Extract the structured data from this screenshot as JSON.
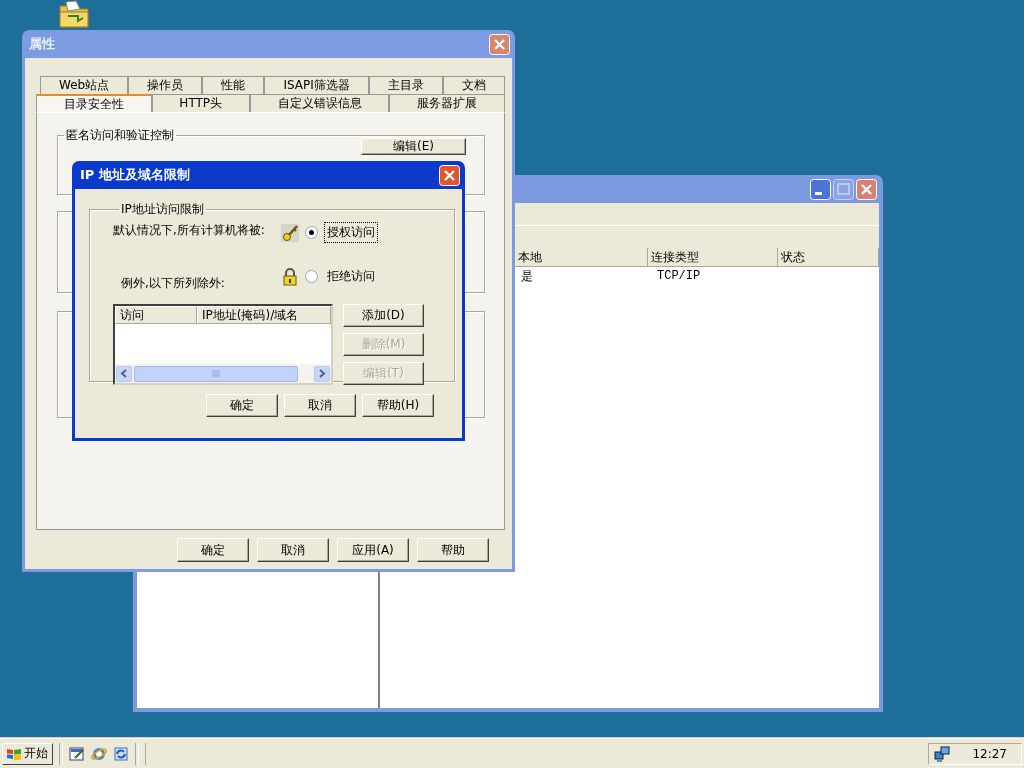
{
  "back_window": {
    "list": {
      "columns": [
        "本地",
        "连接类型",
        "状态"
      ],
      "rows": [
        {
          "cells": [
            "是",
            "TCP/IP"
          ]
        }
      ]
    }
  },
  "properties_window": {
    "title": "属性",
    "tab_rows": [
      [
        {
          "label": "Web站点",
          "selected": false
        },
        {
          "label": "操作员",
          "selected": false
        },
        {
          "label": "性能",
          "selected": false
        },
        {
          "label": "ISAPI筛选器",
          "selected": false
        },
        {
          "label": "主目录",
          "selected": false
        },
        {
          "label": "文档",
          "selected": false
        }
      ],
      [
        {
          "label": "目录安全性",
          "selected": true
        },
        {
          "label": "HTTP头",
          "selected": false
        },
        {
          "label": "自定义错误信息",
          "selected": false
        },
        {
          "label": "服务器扩展",
          "selected": false
        }
      ]
    ],
    "anonymous_group": {
      "title": "匿名访问和验证控制",
      "button": "编辑(E)"
    },
    "buttons": [
      "确定",
      "取消",
      "应用(A)",
      "帮助"
    ]
  },
  "ip_dialog": {
    "title": "IP 地址及域名限制",
    "group_title": "IP地址访问限制",
    "default_label": "默认情况下,所有计算机将被:",
    "exceptions_label": "例外,以下所列除外:",
    "options": [
      {
        "kind": "key",
        "label": "授权访问",
        "selected": true
      },
      {
        "kind": "lock",
        "label": "拒绝访问",
        "selected": false
      }
    ],
    "list": {
      "columns": [
        "访问",
        "IP地址(掩码)/域名"
      ]
    },
    "side_buttons": [
      {
        "label": "添加(D)",
        "disabled": false
      },
      {
        "label": "删除(M)",
        "disabled": true
      },
      {
        "label": "编辑(T)",
        "disabled": true
      }
    ],
    "buttons": [
      "确定",
      "取消",
      "帮助(H)"
    ]
  },
  "taskbar": {
    "start": "开始",
    "clock": "12:27"
  }
}
